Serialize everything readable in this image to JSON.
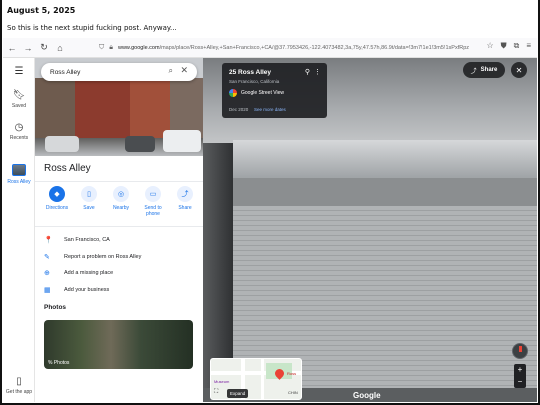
{
  "post": {
    "date": "August 5, 2025",
    "text": "So this is the next stupid fucking post. Anyway..."
  },
  "browser": {
    "url_host": "www.google.com",
    "url_rest": "/maps/place/Ross+Alley,+San+Francisco,+CA/@37.7953426,-122.4073482,3a,75y,47.57h,86.9t/data=!3m7!1e1!3m5!1sPxfRpz",
    "icons": [
      "back-arrow",
      "forward-arrow",
      "reload",
      "home",
      "shield",
      "lock",
      "star",
      "pocket",
      "extensions",
      "menu"
    ]
  },
  "rail": {
    "items": [
      {
        "label": "",
        "icon": "menu"
      },
      {
        "label": "Saved",
        "icon": "bookmark"
      },
      {
        "label": "Recents",
        "icon": "history"
      },
      {
        "label": "Ross Alley",
        "icon": "thumbnail"
      },
      {
        "label": "Get the app",
        "icon": "phone"
      }
    ]
  },
  "panel": {
    "search_value": "Ross Alley",
    "title": "Ross Alley",
    "actions": [
      {
        "label": "Directions",
        "icon": "◆"
      },
      {
        "label": "Save",
        "icon": "▯"
      },
      {
        "label": "Nearby",
        "icon": "◎"
      },
      {
        "label": "Send to phone",
        "icon": "▭"
      },
      {
        "label": "Share",
        "icon": "⤴"
      }
    ],
    "info": [
      {
        "icon": "📍",
        "text": "San Francisco, CA"
      },
      {
        "icon": "✎",
        "text": "Report a problem on Ross Alley"
      },
      {
        "icon": "⊕",
        "text": "Add a missing place"
      },
      {
        "icon": "▦",
        "text": "Add your business"
      }
    ],
    "photos_label": "Photos",
    "photos_count": "% Photos"
  },
  "streetview": {
    "card_title": "25 Ross Alley",
    "card_subtitle": "San Francisco, California",
    "brand": "Google Street View",
    "date": "Dec 2020",
    "see_more": "See more dates",
    "share_label": "Share",
    "minimap": {
      "expand_label": "Expand",
      "labels": [
        "Ross",
        "Museum",
        "CHIN"
      ]
    },
    "watermark": "Google"
  },
  "colors": {
    "accent": "#1a73e8",
    "dark_overlay": "#202124"
  }
}
